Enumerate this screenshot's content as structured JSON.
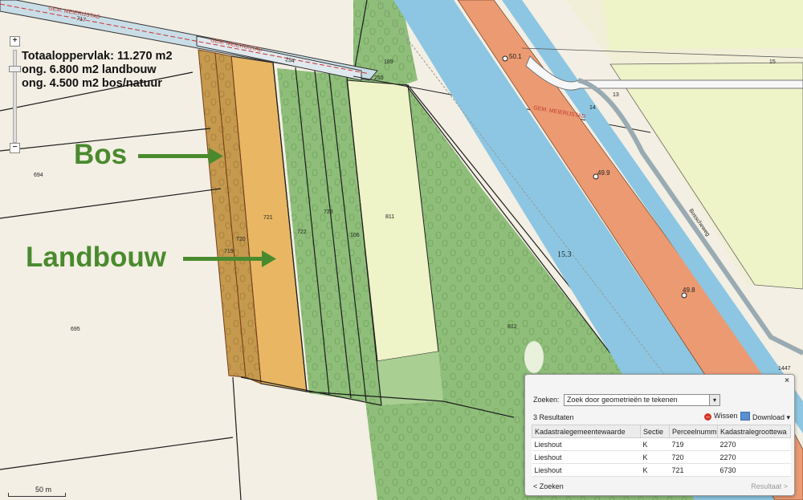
{
  "info": {
    "line1": "Totaaloppervlak: 11.270 m2",
    "line2": "ong. 6.800 m2 landbouw",
    "line3": "ong. 4.500 m2 bos/natuur"
  },
  "annotations": {
    "bos": "Bos",
    "landbouw": "Landbouw"
  },
  "map_labels": {
    "gem_meierijstad_1": "GEM. MEIERIJSTAD",
    "gem_meierijstad_2": "GEM. MEIERIJSTAD",
    "gem_meierijstad_3": "GEM. MEIERIJSTAD",
    "p717": "717",
    "p254": "254",
    "p189": "189",
    "p255": "255",
    "p694": "694",
    "p695": "695",
    "p719": "719",
    "p720": "720",
    "p721": "721",
    "p722": "722",
    "p723": "723",
    "p106": "106",
    "p811": "811",
    "p812": "812",
    "p15": "15",
    "p14": "14",
    "p13": "13",
    "p1447": "1447",
    "elev_50": "50.1",
    "elev_49_9": "49.9",
    "elev_49_8": "49.8",
    "elev_15_3": "15.3",
    "road": "Bosscheweg"
  },
  "zoom": {
    "in": "+",
    "out": "−"
  },
  "scale": "50 m",
  "colors": {
    "forest": "#8fbe7a",
    "agriculture": "#e9b763",
    "canal": "#8cc6e2",
    "road": "#ec9a72",
    "farmland": "#f3efe4",
    "annotation": "#4a8a2e"
  },
  "panel": {
    "close": "×",
    "zoeken_label": "Zoeken:",
    "zoeken_value": "Zoek door geometrieën te tekenen",
    "result_count": "3 Resultaten",
    "wissen": "Wissen",
    "download": "Download",
    "columns": [
      "Kadastralegemeentewaarde",
      "Sectie",
      "Perceelnummer",
      "Kadastralegroottewa"
    ],
    "rows": [
      [
        "Lieshout",
        "K",
        "719",
        "2270"
      ],
      [
        "Lieshout",
        "K",
        "720",
        "2270"
      ],
      [
        "Lieshout",
        "K",
        "721",
        "6730"
      ]
    ],
    "footer_left": "< Zoeken",
    "footer_right": "Resultaat >"
  }
}
